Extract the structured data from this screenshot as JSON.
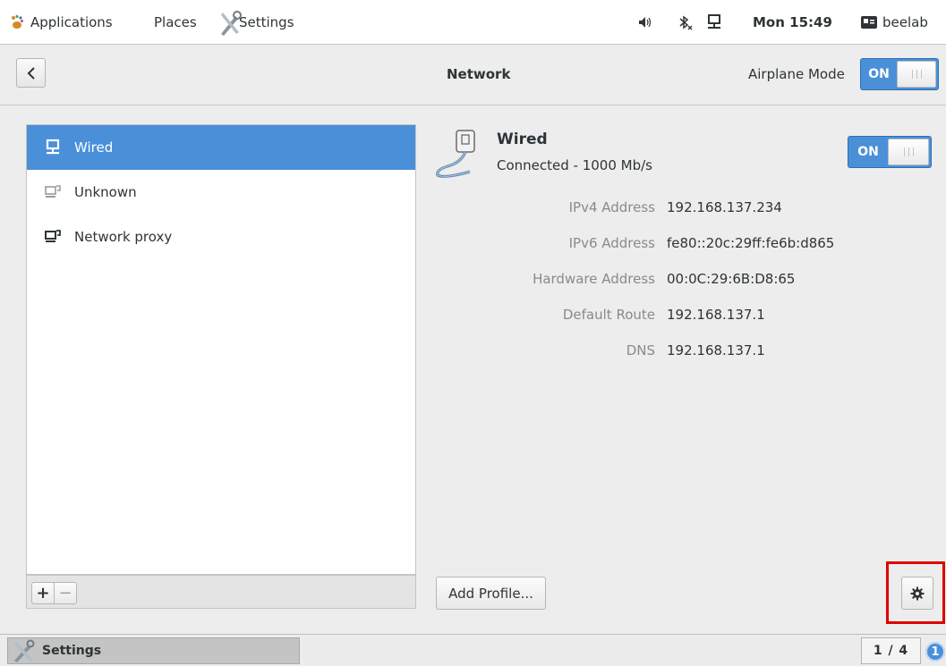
{
  "top_panel": {
    "applications": "Applications",
    "places": "Places",
    "app_name": "Settings",
    "clock": "Mon 15:49",
    "user": "beelab",
    "icons": [
      "gnome-foot-icon",
      "settings-tools-icon",
      "volume-icon",
      "bluetooth-off-icon",
      "network-wired-icon",
      "user-icon"
    ]
  },
  "header": {
    "back_icon": "chevron-left-icon",
    "title": "Network",
    "airplane_label": "Airplane Mode",
    "airplane_state": "ON"
  },
  "devices": [
    {
      "label": "Wired",
      "icon": "network-wired-icon",
      "selected": true
    },
    {
      "label": "Unknown",
      "icon": "network-unknown-icon",
      "selected": false
    },
    {
      "label": "Network proxy",
      "icon": "network-proxy-icon",
      "selected": false
    }
  ],
  "list_toolbar": {
    "add": "+",
    "remove": "−"
  },
  "details": {
    "title": "Wired",
    "status": "Connected - 1000 Mb/s",
    "switch_state": "ON",
    "rows": [
      {
        "key": "IPv4 Address",
        "value": "192.168.137.234"
      },
      {
        "key": "IPv6 Address",
        "value": "fe80::20c:29ff:fe6b:d865"
      },
      {
        "key": "Hardware Address",
        "value": "00:0C:29:6B:D8:65"
      },
      {
        "key": "Default Route",
        "value": "192.168.137.1"
      },
      {
        "key": "DNS",
        "value": "192.168.137.1"
      }
    ],
    "add_profile": "Add Profile...",
    "options_icon": "gear-icon"
  },
  "bottom_panel": {
    "task": "Settings",
    "workspace": "1 / 4",
    "notifications": "1"
  },
  "colors": {
    "accent": "#4a90d9",
    "highlight": "#e00000"
  }
}
